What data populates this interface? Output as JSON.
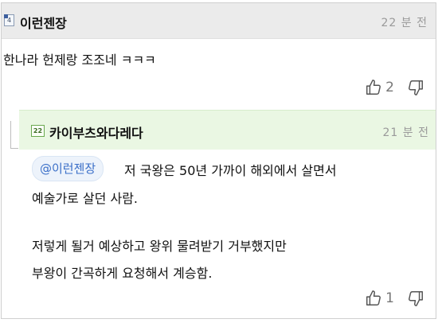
{
  "comments": [
    {
      "author": "이런젠장",
      "level_badge": "4",
      "time": "22 분 전",
      "body": "한나라 헌제랑 조조네 ㅋㅋㅋ",
      "upvotes": "2"
    }
  ],
  "reply": {
    "author": "카이부츠와다레다",
    "level_badge": "22",
    "time": "21 분 전",
    "mention": "@이런젠장",
    "lines": [
      "저 국왕은 50년 가까이 해외에서 살면서",
      "예술가로 살던 사람.",
      "저렇게 될거 예상하고 왕위 물려받기 거부했지만",
      "부왕이 간곡하게 요청해서 계승함."
    ],
    "upvotes": "1"
  },
  "icons": {
    "upvote": "thumbs-up-icon",
    "downvote": "thumbs-down-icon"
  },
  "colors": {
    "header_bg": "#ebebeb",
    "reply_header_bg": "#eaf7e3",
    "mention_text": "#3b6fc8"
  }
}
